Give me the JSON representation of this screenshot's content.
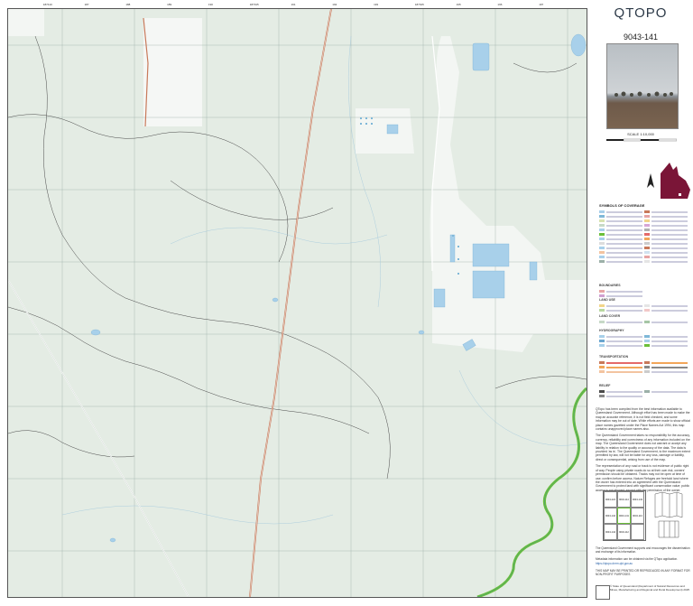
{
  "map": {
    "title": "QTOPO",
    "sheet_number": "9043-141",
    "scale_text": "SCALE 1:10,000",
    "top_ticks": [
      "187410",
      "187",
      "188",
      "189",
      "190",
      "187915",
      "191",
      "192",
      "193",
      "187915",
      "195",
      "196",
      "197"
    ],
    "credit": "© State of Queensland (Department of Natural Resources and Mines, Manufacturing and Regional and Rural Development) 2025"
  },
  "legend": {
    "title": "SYMBOLS OF COVERAGE",
    "sections": [
      "BOUNDARIES",
      "LAND USE",
      "LAND COVER",
      "HYDROGRAPHY",
      "TRANSPORTATION",
      "RELIEF"
    ]
  },
  "disclaimer": {
    "p1": "QTopo has been compiled from the best information available to Queensland Government. Although effort has been made to make the map an accurate reference, it is not field checked, and some information may be out of date. While efforts are made to show official place names gazetted under the Place Names Act 1994, this map contains unapproved place names also.",
    "p2": "The Queensland Government takes no responsibility for the accuracy, currency, reliability and correctness of any information included on the map. The Queensland Government does not warrant or accept any liability in relation to the quality or accuracy of the data. The data is provided 'as is'. The Queensland Government, to the maximum extent permitted by law, will not be liable for any loss, damage or liability, direct or consequential, arising from use of the map.",
    "p3": "The representation of any road or track is not evidence of public right of way. People using private roads do so at their own risk, owners' permission should be obtained. Tracks may not be open at time of use; confirm before access. Nature Refuges are freehold land where the owner has entered into an agreement with the Queensland Government to protect land with significant conservation value; public access is not allowed, except with the permission of the owner."
  },
  "index": {
    "cells": [
      "9043-224",
      "9043-142",
      "9043-141",
      "9043-114",
      "9043-143",
      "9043-113",
      "9043-144",
      "9043-112"
    ]
  },
  "footer": {
    "line1": "The Queensland Government supports and encourages the dissemination and exchange of its information.",
    "line2": "Metadata information can be obtained via the QTopo application.",
    "line3": "https://qtopo.dnrm.qld.gov.au",
    "line4": "THIS MAP MAY BE PRINTED OR REPRODUCED IN ANY FORMAT FOR NON-PROFIT PURPOSES"
  },
  "colors": {
    "vegetation": "#e4ece4",
    "clearing": "#f5f7f5",
    "water": "#a8d0ea",
    "road": "#c8795a",
    "contour": "#4a4a4a",
    "river": "#6bbf3a",
    "maroon": "#7a1537"
  }
}
